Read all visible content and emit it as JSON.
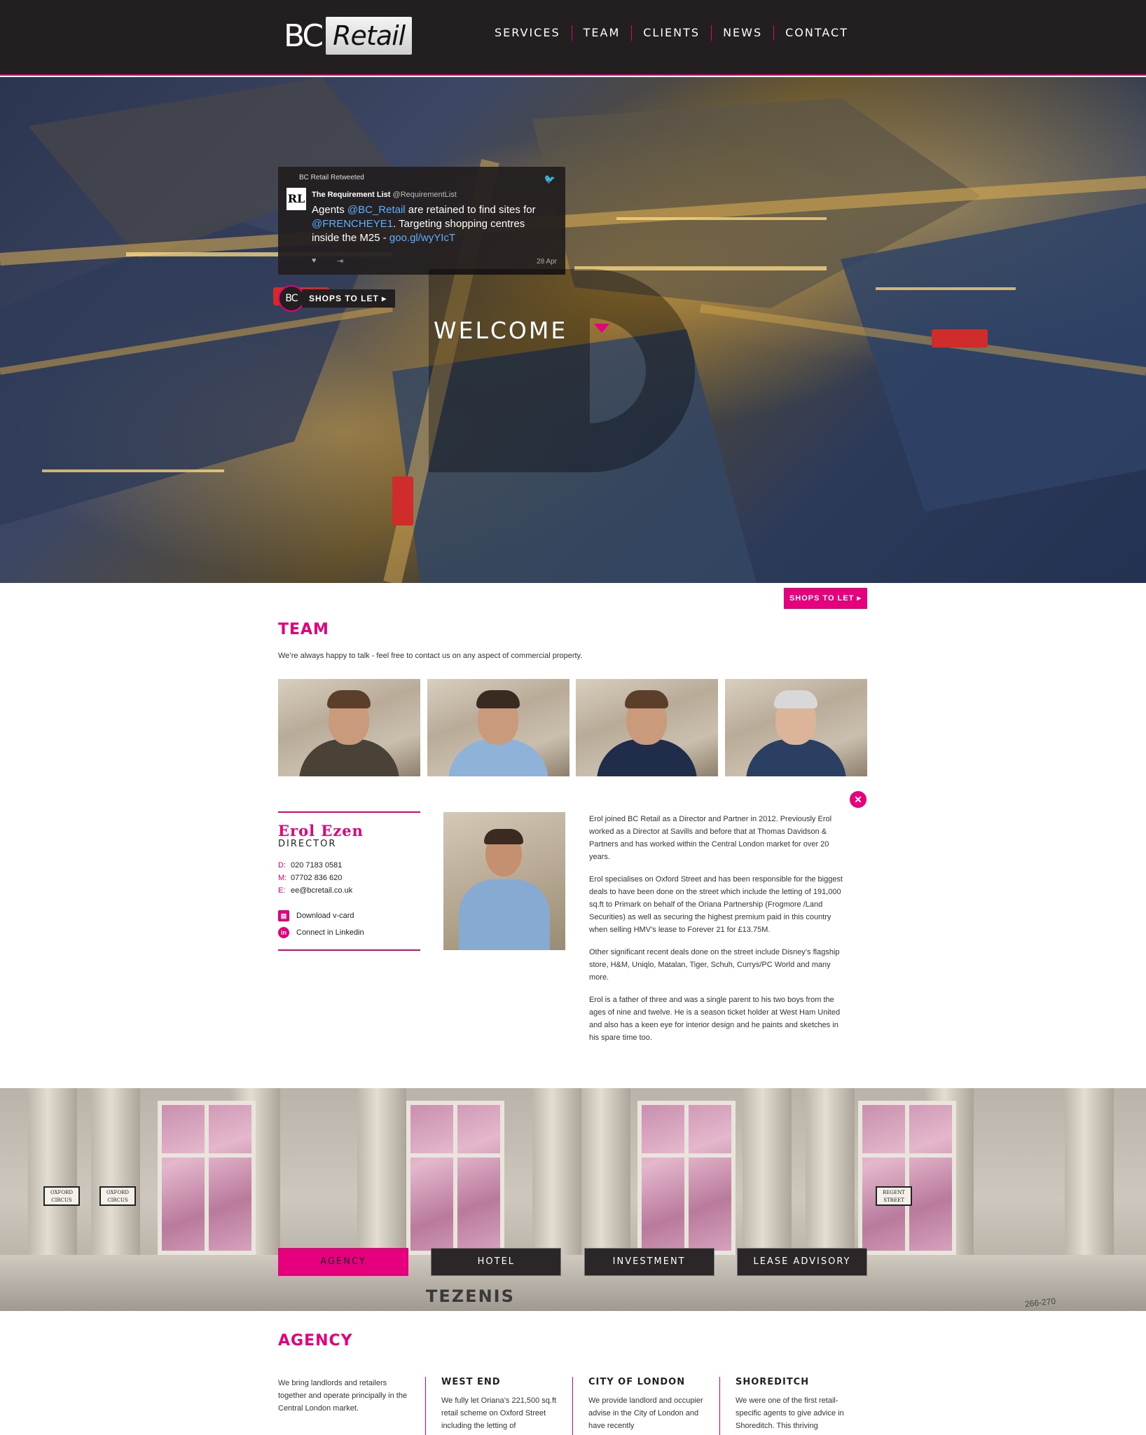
{
  "header": {
    "logo_bc": "BC",
    "logo_retail": "Retail",
    "nav": [
      "SERVICES",
      "TEAM",
      "CLIENTS",
      "NEWS",
      "CONTACT"
    ]
  },
  "tweet": {
    "retweeted_by": "BC Retail Retweeted",
    "avatar_text": "RL",
    "author": "The Requirement List",
    "handle": "@RequirementList",
    "text_part1": "Agents ",
    "mention1": "@BC_Retail",
    "text_part2": " are retained to find sites for ",
    "mention2": "@FRENCHEYE1",
    "text_part3": ". Targeting shopping centres inside the M25 - ",
    "link": "goo.gl/wyYIcT",
    "date": "28 Apr"
  },
  "hero": {
    "badge_logo": "BC",
    "badge_label": "SHOPS TO LET ▸",
    "welcome": "WELCOME"
  },
  "shops_button": "SHOPS TO LET ▸",
  "team": {
    "title": "TEAM",
    "intro": "We’re always happy to talk - feel free to contact us on any aspect of commercial property."
  },
  "profile": {
    "name": "Erol Ezen",
    "role": "DIRECTOR",
    "direct_label": "D:",
    "direct": "020 7183 0581",
    "mobile_label": "M:",
    "mobile": "07702 836 620",
    "email_label": "E:",
    "email": "ee@bcretail.co.uk",
    "vcard_icon": "vcard-icon",
    "vcard": "Download v-card",
    "linkedin_icon": "in",
    "linkedin": "Connect in Linkedin",
    "close": "✕",
    "bio": [
      "Erol joined BC Retail as a Director and Partner in 2012. Previously Erol worked as a Director at Savills and before that at Thomas Davidson & Partners and has worked within the Central London market for over 20 years.",
      "Erol specialises on Oxford Street and has been responsible for the biggest deals to have been done on the street which include the letting of 191,000 sq.ft to Primark on behalf of the Oriana Partnership (Frogmore /Land Securities) as well as securing the highest premium paid in this country when selling HMV’s lease to Forever 21 for £13.75M.",
      "Other significant recent deals done on the street include Disney’s flagship store, H&M, Uniqlo, Matalan, Tiger, Schuh, Currys/PC World and many more.",
      "Erol is a father of three and was a single parent to his two boys from the ages of nine and twelve. He is a season ticket holder at West Ham United and also has a keen eye for interior design and he paints and sketches in his spare time too."
    ]
  },
  "building": {
    "sign_left": "OXFORD CIRCUS",
    "sign_left2": "OXFORD CIRCUS",
    "sign_right": "REGENT STREET",
    "store": "TEZENIS",
    "number": "266-270"
  },
  "service_tabs": [
    "AGENCY",
    "HOTEL",
    "INVESTMENT",
    "LEASE ADVISORY"
  ],
  "agency": {
    "title": "AGENCY",
    "intro": "We bring landlords and retailers together and operate principally in the Central London market.",
    "columns": [
      {
        "title": "WEST END",
        "text": "We fully let Oriana’s 221,500 sq.ft retail scheme on Oxford Street including the letting of"
      },
      {
        "title": "CITY OF LONDON",
        "text": "We provide landlord and occupier advise in the City of London and have recently"
      },
      {
        "title": "SHOREDITCH",
        "text": "We were one of the first retail-specific agents to give advice in Shoreditch. This thriving"
      }
    ]
  },
  "colors": {
    "accent": "#e6007e",
    "dark": "#231f20"
  }
}
